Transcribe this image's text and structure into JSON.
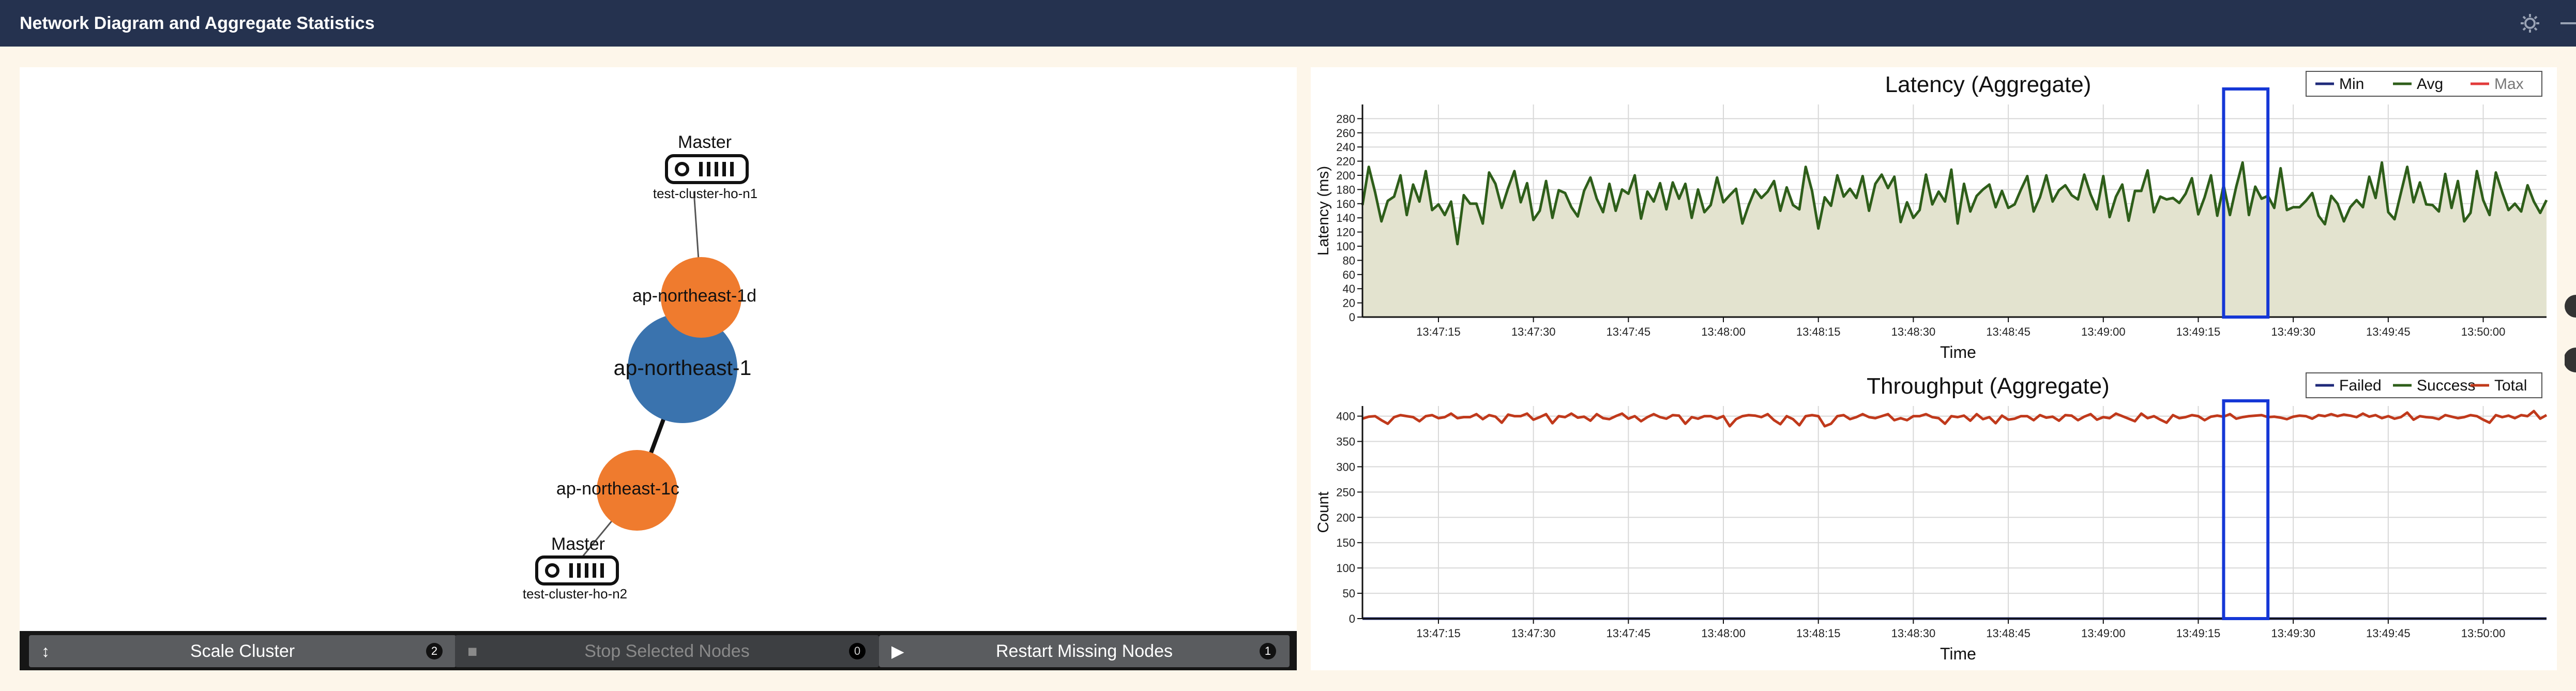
{
  "app": {
    "title": "Network Diagram and Aggregate Statistics"
  },
  "toolbar": {
    "settings_icon": "gear-icon",
    "minimize_icon": "minus-icon"
  },
  "network": {
    "region": "ap-northeast-1",
    "zones": [
      {
        "name": "ap-northeast-1d",
        "host_role": "Master",
        "host_name": "test-cluster-ho-n1"
      },
      {
        "name": "ap-northeast-1c",
        "host_role": "Master",
        "host_name": "test-cluster-ho-n2"
      }
    ],
    "colors": {
      "region": "#3a73ae",
      "zone": "#ef7b2e"
    }
  },
  "controls": [
    {
      "label": "Scale Cluster",
      "icon": "arrows-vertical-icon",
      "glyph": "↕",
      "badge": "2",
      "enabled": true
    },
    {
      "label": "Stop Selected Nodes",
      "icon": "stop-icon",
      "glyph": "■",
      "badge": "0",
      "enabled": false
    },
    {
      "label": "Restart Missing Nodes",
      "icon": "play-icon",
      "glyph": "▶",
      "badge": "1",
      "enabled": true
    }
  ],
  "chart_data": [
    {
      "type": "area",
      "title": "Latency (Aggregate)",
      "xlabel": "Time",
      "ylabel": "Latency (ms)",
      "ylim": [
        0,
        300
      ],
      "yticks": [
        0.0,
        20,
        40,
        60,
        80,
        100,
        120,
        140,
        160,
        180,
        200,
        220,
        240,
        260,
        280
      ],
      "xlim": [
        "13:47:03",
        "13:50:10"
      ],
      "xticks": [
        "13:47:15",
        "13:47:30",
        "13:47:45",
        "13:48:00",
        "13:48:15",
        "13:48:30",
        "13:48:45",
        "13:49:00",
        "13:49:15",
        "13:49:30",
        "13:49:45",
        "13:50:00"
      ],
      "grid": true,
      "legend_position": "top-right",
      "selection": [
        "13:49:19",
        "13:49:26"
      ],
      "series": [
        {
          "name": "Min",
          "color": "#1f2a7a",
          "start": "13:47:03",
          "step_seconds": 1,
          "values": [
            22,
            22,
            21,
            21,
            21,
            22,
            21,
            21,
            22,
            21,
            21,
            21,
            21,
            21,
            22,
            21,
            21,
            21,
            21,
            22,
            21,
            21,
            21,
            21,
            21,
            21,
            22,
            21,
            21,
            21,
            21,
            21,
            21,
            21,
            21,
            21,
            21,
            21,
            21,
            22,
            21,
            21,
            21,
            21,
            21,
            21,
            21,
            22,
            21,
            21,
            22,
            21,
            21,
            21,
            21,
            21,
            22,
            21,
            22,
            21,
            21,
            21,
            21,
            21,
            21,
            22,
            21,
            21,
            21,
            21,
            21,
            21,
            21,
            22,
            21,
            21,
            21,
            21,
            22,
            21,
            21,
            21,
            21,
            21,
            21,
            21,
            22,
            21,
            21,
            21,
            21,
            21,
            21,
            21,
            21,
            21,
            21,
            22,
            21,
            21,
            21,
            21,
            21,
            21,
            21,
            21,
            22,
            21,
            21,
            21,
            21,
            22,
            21,
            21,
            21,
            21,
            21,
            21,
            22,
            21,
            21,
            21,
            21,
            21,
            21,
            21,
            21,
            21,
            21,
            22,
            21,
            21,
            21,
            21,
            21,
            22,
            21,
            21,
            21,
            21,
            21,
            21,
            22,
            21,
            21,
            21,
            21,
            21,
            21,
            21,
            22,
            21,
            21,
            21,
            21,
            21,
            22,
            21,
            21,
            21,
            21,
            21,
            21,
            21,
            22,
            21,
            21,
            21,
            21,
            21,
            21,
            21,
            22,
            21,
            21,
            21,
            21,
            22,
            21,
            21,
            21,
            21,
            21,
            22,
            21,
            21,
            21,
            21
          ]
        },
        {
          "name": "Avg",
          "color": "#2e5e1a",
          "fill": "#e3e3cf",
          "start": "13:47:03",
          "step_seconds": 1,
          "values": [
            158,
            212,
            176,
            135,
            164,
            170,
            200,
            144,
            187,
            163,
            206,
            151,
            159,
            144,
            163,
            103,
            172,
            160,
            160,
            132,
            204,
            188,
            154,
            182,
            206,
            162,
            189,
            137,
            150,
            192,
            140,
            179,
            175,
            155,
            142,
            178,
            197,
            167,
            148,
            188,
            150,
            180,
            174,
            200,
            139,
            177,
            163,
            189,
            152,
            190,
            167,
            188,
            140,
            180,
            148,
            158,
            197,
            162,
            172,
            181,
            132,
            158,
            180,
            168,
            177,
            192,
            150,
            183,
            158,
            152,
            212,
            178,
            125,
            169,
            157,
            200,
            170,
            181,
            168,
            199,
            150,
            188,
            201,
            182,
            198,
            134,
            162,
            140,
            151,
            201,
            159,
            177,
            163,
            208,
            132,
            188,
            149,
            171,
            180,
            187,
            155,
            178,
            154,
            159,
            180,
            199,
            149,
            169,
            200,
            163,
            179,
            186,
            172,
            166,
            201,
            173,
            152,
            199,
            141,
            170,
            187,
            136,
            178,
            178,
            207,
            148,
            170,
            166,
            168,
            161,
            174,
            196,
            145,
            169,
            200,
            143,
            186,
            144,
            184,
            218,
            144,
            184,
            167,
            171,
            154,
            210,
            151,
            155,
            155,
            164,
            175,
            143,
            131,
            171,
            160,
            135,
            155,
            165,
            155,
            198,
            168,
            218,
            148,
            138,
            175,
            212,
            162,
            190,
            159,
            158,
            149,
            202,
            154,
            192,
            135,
            147,
            206,
            165,
            144,
            204,
            176,
            151,
            160,
            149,
            186,
            163,
            147,
            165
          ]
        },
        {
          "name": "Max",
          "color": "#e23b3b"
        }
      ]
    },
    {
      "type": "line",
      "title": "Throughput (Aggregate)",
      "xlabel": "Time",
      "ylabel": "Count",
      "ylim": [
        0,
        420
      ],
      "yticks": [
        0.0,
        50,
        100,
        150,
        200,
        250,
        300,
        350,
        400
      ],
      "xlim": [
        "13:47:03",
        "13:50:10"
      ],
      "xticks": [
        "13:47:15",
        "13:47:30",
        "13:47:45",
        "13:48:00",
        "13:48:15",
        "13:48:30",
        "13:48:45",
        "13:49:00",
        "13:49:15",
        "13:49:30",
        "13:49:45",
        "13:50:00"
      ],
      "grid": true,
      "legend_position": "top-right",
      "selection": [
        "13:49:19",
        "13:49:26"
      ],
      "series": [
        {
          "name": "Failed",
          "color": "#1f2a7a",
          "start": "13:47:03",
          "step_seconds": 1,
          "values": [
            0,
            0,
            0,
            0,
            0,
            0,
            0,
            0,
            0,
            0,
            0,
            0,
            0,
            0,
            0,
            0,
            0,
            0,
            0,
            0,
            0,
            0,
            0,
            0,
            0,
            0,
            0,
            0,
            0,
            0,
            0,
            0,
            0,
            0,
            0,
            0,
            0,
            0,
            0,
            0,
            0,
            0,
            0,
            0,
            0,
            0,
            0,
            0,
            0,
            0,
            0,
            0,
            0,
            0,
            0,
            0,
            0,
            0,
            0,
            0,
            0,
            0,
            0,
            0,
            0,
            0,
            0,
            0,
            0,
            0,
            0,
            0,
            0,
            0,
            0,
            0,
            0,
            0,
            0,
            0,
            0,
            0,
            0,
            0,
            0,
            0,
            0,
            0,
            0,
            0,
            0,
            0,
            0,
            0,
            0,
            0,
            0,
            0,
            0,
            0,
            0,
            0,
            0,
            0,
            0,
            0,
            0,
            0,
            0,
            0,
            0,
            0,
            0,
            0,
            0,
            0,
            0,
            0,
            0,
            0,
            0,
            0,
            0,
            0,
            0,
            0,
            0,
            0,
            0,
            0,
            0,
            0,
            0,
            0,
            0,
            0,
            0,
            0,
            0,
            0,
            0,
            0,
            0,
            0,
            0,
            0,
            0,
            0,
            0,
            0,
            0,
            0,
            0,
            0,
            0,
            0,
            0,
            0,
            0,
            0,
            0,
            0,
            0,
            0,
            0,
            0,
            0,
            0,
            0,
            0,
            0,
            0,
            0,
            0,
            0,
            0,
            0,
            0,
            0,
            0,
            0,
            0,
            0,
            0,
            0,
            0,
            0,
            0
          ]
        },
        {
          "name": "Success",
          "color": "#2e5e1a"
        },
        {
          "name": "Total",
          "color": "#c0391b",
          "start": "13:47:03",
          "step_seconds": 1,
          "values": [
            395,
            399,
            400,
            392,
            385,
            398,
            402,
            400,
            398,
            390,
            400,
            402,
            396,
            398,
            405,
            396,
            398,
            398,
            404,
            394,
            402,
            399,
            387,
            403,
            400,
            400,
            405,
            393,
            398,
            404,
            386,
            400,
            398,
            405,
            397,
            399,
            391,
            404,
            396,
            394,
            400,
            405,
            395,
            400,
            390,
            398,
            404,
            398,
            395,
            402,
            401,
            385,
            398,
            395,
            400,
            400,
            395,
            400,
            380,
            394,
            400,
            402,
            401,
            398,
            404,
            392,
            384,
            400,
            394,
            382,
            400,
            402,
            400,
            380,
            385,
            400,
            402,
            394,
            398,
            404,
            398,
            396,
            400,
            404,
            392,
            396,
            392,
            400,
            400,
            404,
            398,
            396,
            385,
            400,
            398,
            401,
            391,
            404,
            394,
            398,
            386,
            401,
            393,
            395,
            400,
            400,
            392,
            402,
            397,
            399,
            391,
            402,
            401,
            392,
            399,
            404,
            393,
            398,
            396,
            405,
            400,
            395,
            390,
            405,
            396,
            400,
            393,
            387,
            402,
            396,
            398,
            402,
            400,
            392,
            399,
            401,
            399,
            404,
            395,
            398,
            400,
            401,
            402,
            398,
            399,
            397,
            394,
            399,
            401,
            400,
            395,
            402,
            400,
            404,
            400,
            403,
            401,
            398,
            405,
            399,
            402,
            396,
            400,
            395,
            398,
            407,
            393,
            400,
            398,
            397,
            394,
            402,
            399,
            396,
            398,
            402,
            400,
            393,
            387,
            402,
            398,
            401,
            396,
            402,
            400,
            410,
            395,
            402
          ]
        }
      ]
    }
  ]
}
